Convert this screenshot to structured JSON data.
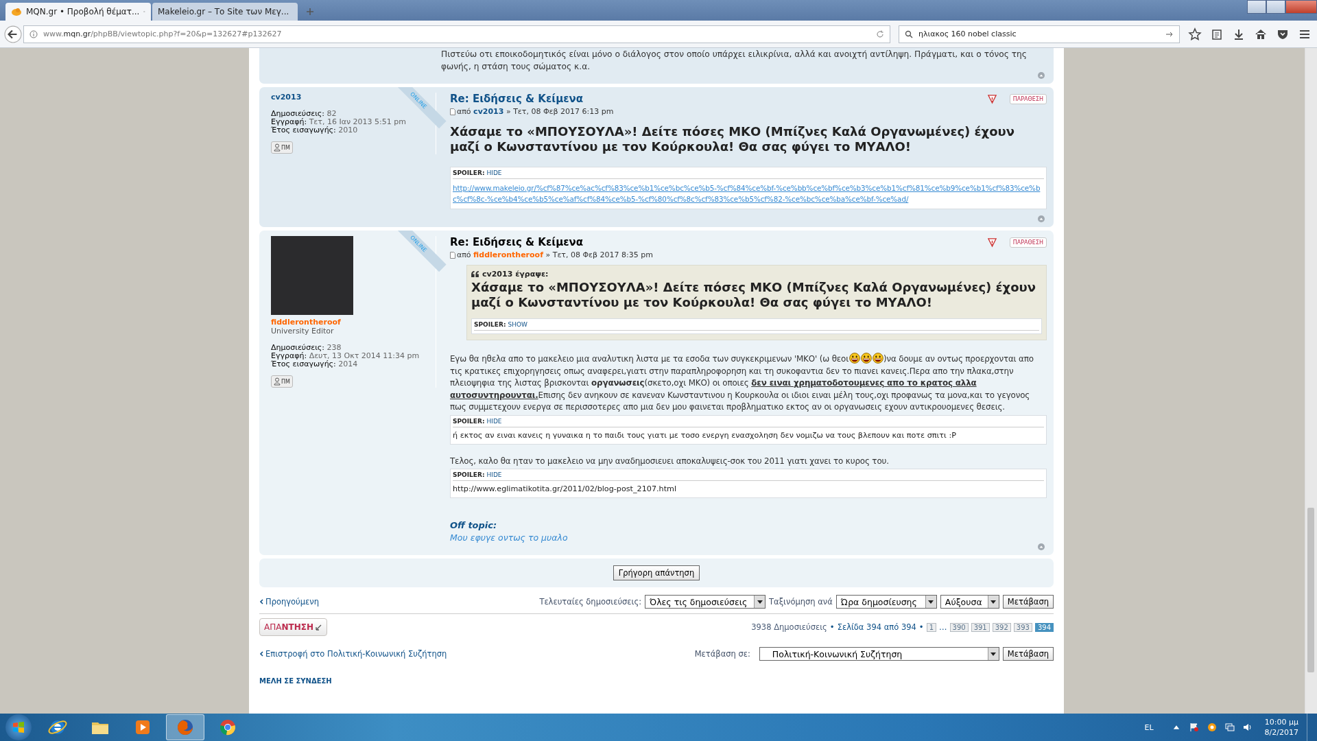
{
  "browser": {
    "tabs": [
      {
        "title": "MQN.gr • Προβολή θέματ...",
        "selected": true
      },
      {
        "title": "Makeleio.gr – Το Site των Μεγ...",
        "selected": false
      }
    ],
    "url": "www.**mqn.gr**/phpBB/viewtopic.php?f=20&p=132627#p132627",
    "search": "ηλιακος 160 nobel classic"
  },
  "previous_post": {
    "text": "Πιστεύω οτι εποικοδομητικός είναι μόνο ο διάλογος στον οποίο υπάρχει ειλικρίνια, αλλά και ανοιχτή αντίληψη. Πράγματι, και ο τόνος της φωνής, η στάση τους σώματος κ.α."
  },
  "posts": [
    {
      "author": "cv2013",
      "color": "#105289",
      "has_avatar": false,
      "online_badge": "ONLINE",
      "stats": [
        {
          "label": "Δημοσιεύσεις:",
          "value": "82"
        },
        {
          "label": "Εγγραφή:",
          "value": "Τετ, 16 Ιαν 2013 5:51 pm"
        },
        {
          "label": "Έτος εισαγωγής:",
          "value": "2010"
        }
      ],
      "pm": "ΠΜ",
      "title": "Re: Ειδήσεις & Κείμενα",
      "current": false,
      "by": "από",
      "byline_author": "cv2013",
      "date": "» Τετ, 08 Φεβ 2017 6:13 pm",
      "quote_button": "ΠΑΡΑΘΕΣΗ",
      "blocks": [
        {
          "kind": "heading",
          "text": "Χάσαμε το «ΜΠΟΥΣΟΥΛΑ»! Δείτε πόσες ΜΚΟ (Μπίζνες Καλά Οργανωμένες) έχουν μαζί ο Κωνσταντίνου με τον Κούρκουλα! Θα σας φύγει το ΜΥΑΛΟ!"
        },
        {
          "kind": "spoiler",
          "label": "SPOILER:",
          "toggle": "HIDE",
          "link": true,
          "text": "http://www.makeleio.gr/%cf%87%ce%ac%cf%83%ce%b1%ce%bc%ce%b5-%cf%84%ce%bf-%ce%bb%ce%bf%ce%b3%ce%b1%cf%81%ce%b9%ce%b1%cf%83%ce%bc%cf%8c-%ce%b4%ce%b5%ce%af%cf%84%ce%b5-%cf%80%cf%8c%cf%83%ce%b5%cf%82-%ce%bc%ce%ba%ce%bf-%ce%ad/"
        }
      ]
    },
    {
      "author": "fiddlerontheroof",
      "color": "#ff6600",
      "has_avatar": true,
      "rank": "University Editor",
      "online_badge": "ONLINE",
      "stats": [
        {
          "label": "Δημοσιεύσεις:",
          "value": "238"
        },
        {
          "label": "Εγγραφή:",
          "value": "Δευτ, 13 Οκτ 2014 11:34 pm"
        },
        {
          "label": "Έτος εισαγωγής:",
          "value": "2014"
        }
      ],
      "pm": "ΠΜ",
      "title": "Re: Ειδήσεις & Κείμενα",
      "current": true,
      "by": "από",
      "byline_author": "fiddlerontheroof",
      "date": "» Τετ, 08 Φεβ 2017 8:35 pm",
      "quote_button": "ΠΑΡΑΘΕΣΗ",
      "blocks": [
        {
          "kind": "quote",
          "cite": "cv2013 έγραψε:",
          "heading": "Χάσαμε το «ΜΠΟΥΣΟΥΛΑ»! Δείτε πόσες ΜΚΟ (Μπίζνες Καλά Οργανωμένες) έχουν μαζί ο Κωνσταντίνου με τον Κούρκουλα! Θα σας φύγει το ΜΥΑΛΟ!",
          "spoiler_label": "SPOILER:",
          "spoiler_toggle": "SHOW"
        },
        {
          "kind": "paragraph",
          "segments": [
            {
              "kind": "text",
              "text": "Εγω θα ηθελα απο το μακελειο μια αναλυτικη λιστα με τα εσοδα των συγκεκριμενων 'ΜΚΟ' (ω θεοι"
            },
            {
              "kind": "smiley"
            },
            {
              "kind": "smiley"
            },
            {
              "kind": "smiley"
            },
            {
              "kind": "text",
              "text": ")να δουμε αν οντως προερχονται απο τις κρατικες επιχορηγησεις οπως αναφερει,γιατι στην παραπληροφορηση και τη συκοφαντια δεν το πιανει κανεις.Περα απο την πλακα,στην πλειοψηφια της λιστας βρισκονται **οργανωσεις**(σκετο,οχι ΜΚΟ) οι οποιες "
            },
            {
              "kind": "underlined",
              "text": "δεν ειναι χρηματοδοτουμενες απο το κρατος αλλα αυτοσυντηρουνται."
            },
            {
              "kind": "text",
              "text": "Επισης δεν ανηκουν σε κανεναν Κωνσταντινου η Κουρκουλα οι ιδιοι ειναι μέλη τους,οχι προφανως τα μονα,και το γεγονος πως συμμετεχουν ενεργα σε περισσοτερες απο μια δεν μου φαινεται προβληματικο εκτος αν οι οργανωσεις εχουν αντικρουομενες θεσεις."
            }
          ]
        },
        {
          "kind": "spoiler",
          "label": "SPOILER:",
          "toggle": "HIDE",
          "link": false,
          "text": "ή εκτος αν ειναι κανεις η γυναικα η το παιδι τους γιατι με τοσο ενεργη ενασχοληση δεν νομιζω να τους βλεπουν και ποτε σπιτι :P"
        },
        {
          "kind": "paragraph",
          "segments": [
            {
              "kind": "text",
              "text": "Τελος, καλο θα ηταν το μακελειο να μην αναδημοσιευει αποκαλυψεις-σοκ του 2011 γιατι χανει το κυρος του."
            }
          ]
        },
        {
          "kind": "spoiler",
          "label": "SPOILER:",
          "toggle": "HIDE",
          "link": false,
          "text": "http://www.eglimatikotita.gr/2011/02/blog-post_2107.html"
        },
        {
          "kind": "offtopic",
          "title": "Off topic:",
          "text": "Μου εφυγε οντως το μυαλο"
        }
      ]
    }
  ],
  "quick_reply": "Γρήγορη απάντηση",
  "display_options": {
    "previous": "Προηγούμενη",
    "posts_label": "Τελευταίες δημοσιεύσεις:",
    "posts_value": "Όλες τις δημοσιεύσεις",
    "sort_label": "Ταξινόμηση ανά",
    "sort_value": "Ώρα δημοσίευσης",
    "order_value": "Αύξουσα",
    "go": "Μετάβαση"
  },
  "reply_button": "ΑΠΑ**ΝΤΗΣΗ**",
  "pagination": {
    "count": "3938 Δημοσιεύσεις",
    "page_info": "Σελίδα 394 από 394",
    "separator": "•",
    "pages": [
      {
        "kind": "page",
        "label": "1",
        "selected": false
      },
      {
        "kind": "ellipsis",
        "label": "…"
      },
      {
        "kind": "page",
        "label": "390",
        "selected": false
      },
      {
        "kind": "page",
        "label": "391",
        "selected": false
      },
      {
        "kind": "page",
        "label": "392",
        "selected": false
      },
      {
        "kind": "page",
        "label": "393",
        "selected": false
      },
      {
        "kind": "page",
        "label": "394",
        "selected": true
      }
    ]
  },
  "jump": {
    "back": "Επιστροφή στο Πολιτική-Κοινωνική Συζήτηση",
    "label": "Μετάβαση σε:",
    "value": "Πολιτική-Κοινωνική Συζήτηση",
    "go": "Μετάβαση"
  },
  "online_heading": "ΜΕΛΗ ΣΕ ΣΥΝΔΕΣΗ",
  "taskbar": {
    "apps": [
      {
        "kind": "ie",
        "selected": false
      },
      {
        "kind": "folder",
        "selected": false
      },
      {
        "kind": "media",
        "selected": false
      },
      {
        "kind": "firefox",
        "selected": true
      },
      {
        "kind": "chrome",
        "selected": false
      }
    ],
    "language": "EL",
    "time": "10:00 μμ",
    "date": "8/2/2017"
  }
}
